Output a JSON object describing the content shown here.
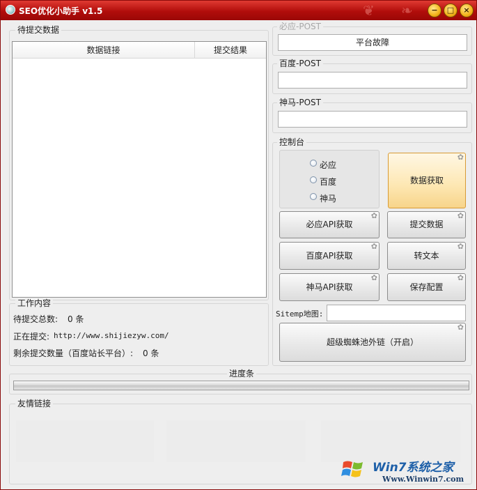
{
  "window": {
    "title": "SEO优化小助手 v1.5"
  },
  "title_buttons": {
    "minimize": "−",
    "maximize": "□",
    "close": "×"
  },
  "pending_group": {
    "title": "待提交数据",
    "columns": [
      "数据链接",
      "提交结果"
    ]
  },
  "bing_post": {
    "label": "必应-POST",
    "value": "平台故障"
  },
  "baidu_post": {
    "label": "百度-POST",
    "value": ""
  },
  "shenma_post": {
    "label": "神马-POST",
    "value": ""
  },
  "console": {
    "title": "控制台",
    "radio_options": [
      "必应",
      "百度",
      "神马"
    ],
    "buttons": {
      "fetch_data": "数据获取",
      "bing_api": "必应API获取",
      "submit_data": "提交数据",
      "baidu_api": "百度API获取",
      "to_text": "转文本",
      "shenma_api": "神马API获取",
      "save_config": "保存配置",
      "spider_pool": "超级蜘蛛池外链（开启）"
    },
    "sitemap": {
      "label": "Sitemp地图:",
      "value": ""
    }
  },
  "work_group": {
    "title": "工作内容",
    "pending_total_label": "待提交总数:",
    "pending_total_value": "0 条",
    "submitting_label": "正在提交:",
    "submitting_url": "http://www.shijiezyw.com/",
    "remaining_label": "剩余提交数量（百度站长平台）:",
    "remaining_value": "0 条"
  },
  "progress": {
    "label": "进度条",
    "value": 0
  },
  "friend_links": {
    "title": "友情链接"
  },
  "watermark": {
    "brand": "Win7系统之家",
    "url": "Www.Winwin7.com"
  }
}
